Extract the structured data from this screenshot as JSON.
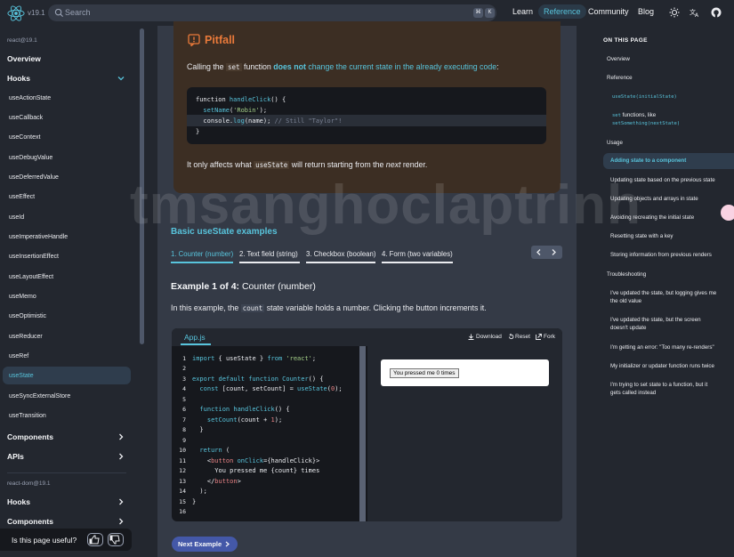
{
  "header": {
    "version": "v19.1",
    "search_placeholder": "Search",
    "kbd1": "⌘",
    "kbd2": "K",
    "nav": [
      "Learn",
      "Reference",
      "Community",
      "Blog"
    ]
  },
  "sidebar": {
    "section1": "react@19.1",
    "overview": "Overview",
    "hooks": "Hooks",
    "hook_items": [
      "useActionState",
      "useCallback",
      "useContext",
      "useDebugValue",
      "useDeferredValue",
      "useEffect",
      "useId",
      "useImperativeHandle",
      "useInsertionEffect",
      "useLayoutEffect",
      "useMemo",
      "useOptimistic",
      "useReducer",
      "useRef",
      "useState",
      "useSyncExternalStore",
      "useTransition"
    ],
    "components": "Components",
    "apis": "APIs",
    "section2": "react-dom@19.1",
    "hooks2": "Hooks",
    "components2": "Components"
  },
  "feedback": {
    "question": "Is this page useful?"
  },
  "pitfall": {
    "title": "Pitfall",
    "text_pre": "Calling the ",
    "text_code": "set",
    "text_mid": " function ",
    "text_bold": "does not",
    "text_link": " change the current state in the already executing code",
    "text_end": ":",
    "code": {
      "line1_kw": "function",
      "line1_fn": " handleClick",
      "line1_rest": "() {",
      "line2_fn": "  setName",
      "line2_str": "'Robin'",
      "line3_obj": "  console.",
      "line3_fn": "log",
      "line3_rest": "(name); ",
      "line3_comment": "// Still \"Taylor\"!",
      "line4": "}"
    },
    "bottom_pre": "It only affects what ",
    "bottom_code": "useState",
    "bottom_mid": " will return starting from the ",
    "bottom_em": "next",
    "bottom_end": " render."
  },
  "watermark": "tmsanghoclaptrinh",
  "examples": {
    "heading": "Basic useState examples",
    "tabs": [
      "1. Counter (number)",
      "2. Text field (string)",
      "3. Checkbox (boolean)",
      "4. Form (two variables)"
    ],
    "title_bold": "Example 1 of 4:",
    "title_rest": " Counter (number)",
    "desc_pre": "In this example, the ",
    "desc_code": "count",
    "desc_post": " state variable holds a number. Clicking the button increments it."
  },
  "sandbox": {
    "file": "App.js",
    "download": "Download",
    "reset": "Reset",
    "fork": "Fork",
    "line_numbers": [
      "1",
      "2",
      "3",
      "4",
      "5",
      "6",
      "7",
      "8",
      "9",
      "10",
      "11",
      "12",
      "13",
      "14",
      "15",
      "16"
    ],
    "preview_button": "You pressed me 0 times"
  },
  "next_example": "Next Example",
  "toc": {
    "heading": "ON THIS PAGE",
    "items": {
      "overview": "Overview",
      "reference": "Reference",
      "usestate_code": "useState(initialState)",
      "set_code": "set",
      "set_text": " functions, like",
      "setsomething_code": "setSomething(nextState)",
      "usage": "Usage",
      "adding": "Adding state to a component",
      "updating_prev": "Updating state based on the previous state",
      "updating_obj": "Updating objects and arrays in state",
      "avoiding": "Avoiding recreating the initial state",
      "resetting": "Resetting state with a key",
      "storing": "Storing information from previous renders",
      "troubleshooting": "Troubleshooting",
      "t1a": "I've updated the state, but logging gives me",
      "t1b": "the old value",
      "t2a": "I've updated the state, but the screen",
      "t2b": "doesn't update",
      "t3": "I'm getting an error: \"Too many re-renders\"",
      "t4": "My initializer or updater function runs twice",
      "t5a": "I'm trying to set state to a function, but it",
      "t5b": "gets called instead"
    }
  }
}
